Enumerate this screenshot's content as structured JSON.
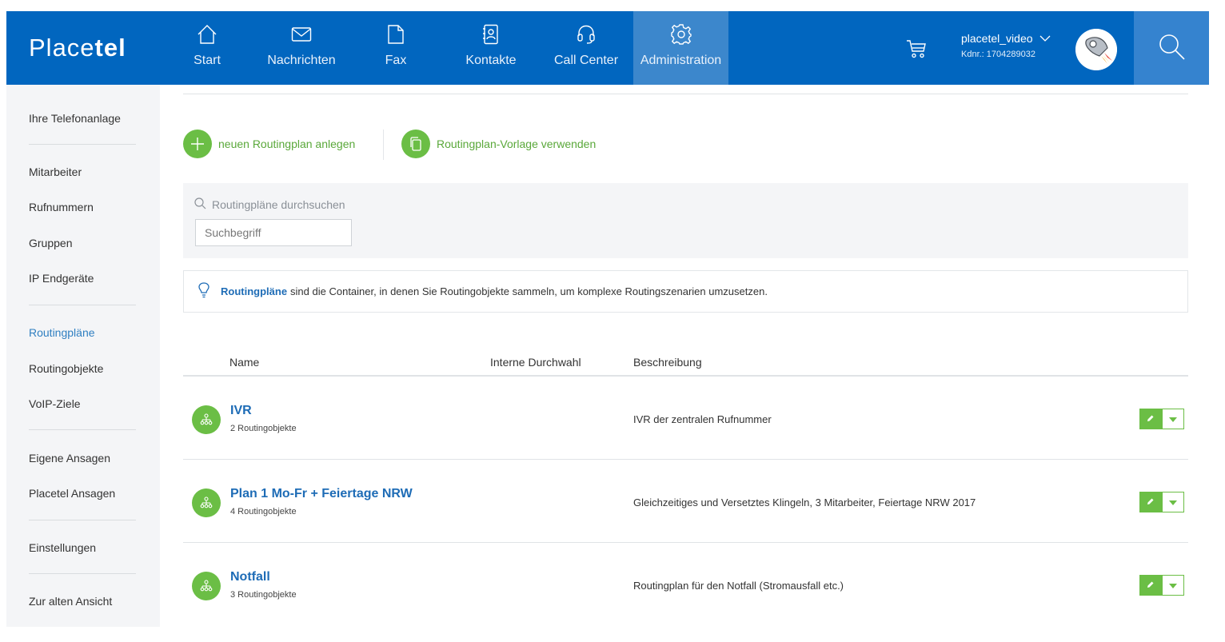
{
  "brand": {
    "logo_part1": "Place",
    "logo_part2": "tel"
  },
  "nav": [
    {
      "label": "Start",
      "icon": "home-icon"
    },
    {
      "label": "Nachrichten",
      "icon": "envelope-icon"
    },
    {
      "label": "Fax",
      "icon": "document-icon"
    },
    {
      "label": "Kontakte",
      "icon": "address-book-icon"
    },
    {
      "label": "Call Center",
      "icon": "headset-icon"
    },
    {
      "label": "Administration",
      "icon": "gear-icon",
      "active": true
    }
  ],
  "user": {
    "name": "placetel_video",
    "customer_no": "Kdnr.: 1704289032"
  },
  "sidebar": {
    "items": [
      {
        "label": "Ihre Telefonanlage"
      },
      {
        "label": "Mitarbeiter"
      },
      {
        "label": "Rufnummern"
      },
      {
        "label": "Gruppen"
      },
      {
        "label": "IP Endgeräte"
      },
      {
        "label": "Routingpläne",
        "active": true
      },
      {
        "label": "Routingobjekte"
      },
      {
        "label": "VoIP-Ziele"
      },
      {
        "label": "Eigene Ansagen"
      },
      {
        "label": "Placetel Ansagen"
      },
      {
        "label": "Einstellungen"
      },
      {
        "label": "Zur alten Ansicht"
      }
    ]
  },
  "actions": {
    "new_plan": "neuen Routingplan anlegen",
    "use_template": "Routingplan-Vorlage verwenden"
  },
  "search": {
    "label": "Routingpläne durchsuchen",
    "placeholder": "Suchbegriff",
    "value": ""
  },
  "info": {
    "link": "Routingpläne",
    "text": "sind die Container, in denen Sie Routingobjekte sammeln, um komplexe Routingszenarien umzusetzen."
  },
  "table": {
    "columns": [
      "Name",
      "Interne Durchwahl",
      "Beschreibung"
    ],
    "rows": [
      {
        "name": "IVR",
        "objects": "2 Routingobjekte",
        "extension": "",
        "description": "IVR der zentralen Rufnummer"
      },
      {
        "name": "Plan 1 Mo-Fr + Feiertage NRW",
        "objects": "4 Routingobjekte",
        "extension": "",
        "description": "Gleichzeitiges und Versetztes Klingeln, 3 Mitarbeiter, Feiertage NRW 2017"
      },
      {
        "name": "Notfall",
        "objects": "3 Routingobjekte",
        "extension": "",
        "description": "Routingplan für den Notfall (Stromausfall etc.)"
      }
    ]
  },
  "colors": {
    "header": "#0166bf",
    "accent_green": "#6bbe45",
    "link_blue": "#1e6cb6"
  }
}
